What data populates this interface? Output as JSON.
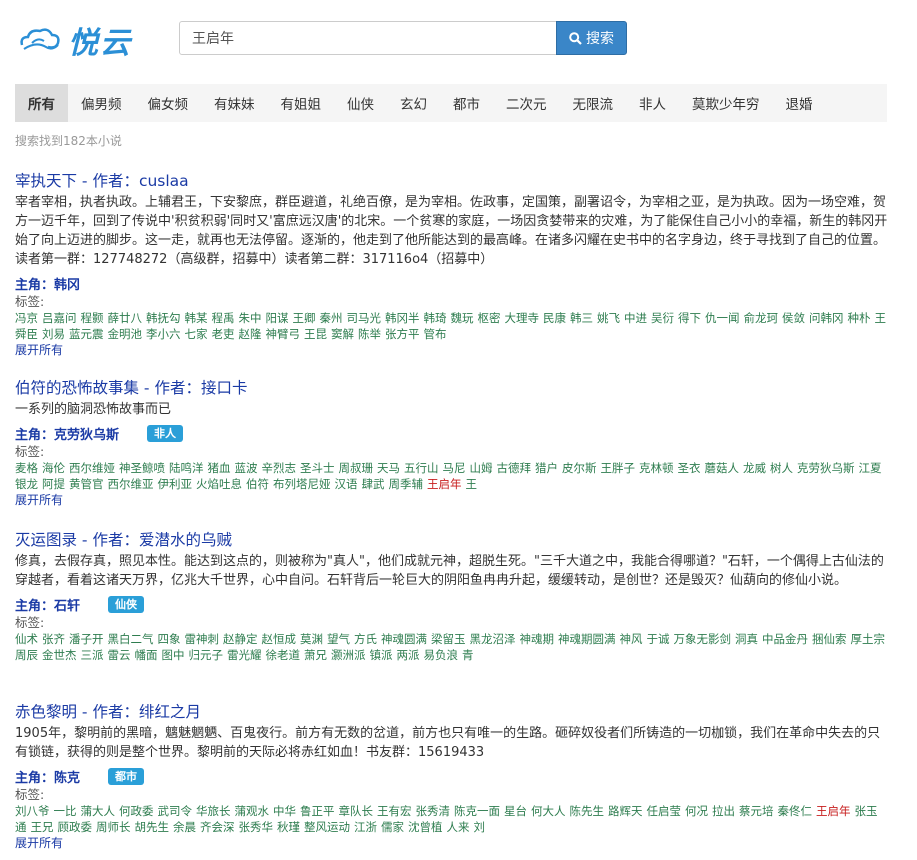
{
  "header": {
    "logo_text": "悦云",
    "search_value": "王启年",
    "search_button": "搜索"
  },
  "nav": [
    "所有",
    "偏男频",
    "偏女频",
    "有妹妹",
    "有姐姐",
    "仙侠",
    "玄幻",
    "都市",
    "二次元",
    "无限流",
    "非人",
    "莫欺少年穷",
    "退婚"
  ],
  "result_count": "搜索找到182本小说",
  "novels": [
    {
      "title": "宰执天下 - 作者：cuslaa",
      "desc": "宰者宰相，执者执政。上辅君王，下安黎庶，群臣避道，礼绝百僚，是为宰相。佐政事，定国策，副署诏令，为宰相之亚，是为执政。因为一场空难，贺方一迈千年，回到了传说中'积贫积弱'同时又'富庶远汉唐'的北宋。一个贫寒的家庭，一场因贪婪带来的灾难，为了能保住自己小小的幸福，新生的韩冈开始了向上迈进的脚步。这一走，就再也无法停留。逐渐的，他走到了他所能达到的最高峰。在诸多闪耀在史书中的名字身边，终于寻找到了自己的位置。读者第一群：127748272（高级群，招募中）读者第二群：317116o4（招募中）",
      "protag_label": "主角：韩冈",
      "badge": "",
      "tags_label": "标签:",
      "tags": [
        "冯京",
        "吕嘉问",
        "程颢",
        "薛廿八",
        "韩抚勾",
        "韩某",
        "程禹",
        "朱中",
        "阳谋",
        "王卿",
        "秦州",
        "司马光",
        "韩冈半",
        "韩琦",
        "魏玩",
        "枢密",
        "大理寺",
        "民康",
        "韩三",
        "姚飞",
        "中进",
        "吴衍",
        "得下",
        "仇一闻",
        "俞龙珂",
        "侯敛",
        "问韩冈",
        "种朴",
        "王舜臣",
        "刘易",
        "蓝元震",
        "金明池",
        "李小六",
        "七家",
        "老吏",
        "赵隆",
        "神臂弓",
        "王昆",
        "窦解",
        "陈举",
        "张方平",
        "管布"
      ],
      "expand": "展开所有"
    },
    {
      "title": "伯符的恐怖故事集 - 作者：接口卡",
      "desc": "一系列的脑洞恐怖故事而已",
      "protag_label": "主角：克劳狄乌斯",
      "badge": "非人",
      "tags_label": "标签:",
      "tags": [
        "麦格",
        "海伦",
        "西尔维娅",
        "神圣鲸喷",
        "陆鸣洋",
        "猪血",
        "蓝波",
        "辛烈志",
        "圣斗士",
        "周叔珊",
        "天马",
        "五行山",
        "马尼",
        "山姆",
        "古德拜",
        "猎户",
        "皮尔斯",
        "王胖子",
        "克林顿",
        "圣衣",
        "蘑菇人",
        "龙威",
        "树人",
        "克劳狄乌斯",
        "江夏",
        "银龙",
        "阿提",
        "黄管官",
        "西尔维亚",
        "伊利亚",
        "火焰吐息",
        "伯符",
        "布列塔尼娅",
        "汉语",
        "肆武",
        "周季辅",
        "王启年",
        "王"
      ],
      "highlight": "王启年",
      "expand": "展开所有"
    },
    {
      "title": "灭运图录 - 作者：爱潜水的乌贼",
      "desc": "修真，去假存真，照见本性。能达到这点的，则被称为\"真人\"，他们成就元神，超脱生死。\"三千大道之中，我能合得哪道？\"石轩，一个偶得上古仙法的穿越者，看着这诸天万界，亿兆大千世界，心中自问。石轩背后一轮巨大的阴阳鱼冉冉升起，缓缓转动，是创世？还是毁灭？仙葫向的修仙小说。",
      "protag_label": "主角：石轩",
      "badge": "仙侠",
      "tags_label": "标签:",
      "tags": [
        "仙术",
        "张齐",
        "潘子开",
        "黑白二气",
        "四象",
        "雷神刺",
        "赵静定",
        "赵恒成",
        "莫渊",
        "望气",
        "方氏",
        "神魂圆满",
        "梁留玉",
        "黑龙沼泽",
        "神魂期",
        "神魂期圆满",
        "神风",
        "于诚",
        "万象无影剑",
        "洞真",
        "中品金丹",
        "捆仙索",
        "厚土宗",
        "周辰",
        "金世杰",
        "三派",
        "雷云",
        "幡面",
        "图中",
        "归元子",
        "雷光耀",
        "徐老道",
        "萧兄",
        "灏洲派",
        "镇派",
        "两派",
        "易负浪",
        "青"
      ],
      "expand": ""
    },
    {
      "title": "赤色黎明 - 作者：绯红之月",
      "desc": "1905年，黎明前的黑暗，魑魅魍魉、百鬼夜行。前方有无数的岔道，前方也只有唯一的生路。砸碎奴役者们所铸造的一切枷锁，我们在革命中失去的只有锁链，获得的则是整个世界。黎明前的天际必将赤红如血！书友群：15619433",
      "protag_label": "主角：陈克",
      "badge": "都市",
      "tags_label": "标签:",
      "tags": [
        "刘八爷",
        "一比",
        "蒲大人",
        "何政委",
        "武司令",
        "华旅长",
        "蒲观水",
        "中华",
        "鲁正平",
        "章队长",
        "王有宏",
        "张秀清",
        "陈克一面",
        "星台",
        "何大人",
        "陈先生",
        "路辉天",
        "任启莹",
        "何况",
        "拉出",
        "蔡元培",
        "秦佟仁",
        "王启年",
        "张玉通",
        "王兄",
        "顾政委",
        "周师长",
        "胡先生",
        "余晨",
        "齐会深",
        "张秀华",
        "秋瑾",
        "整风运动",
        "江浙",
        "儒家",
        "沈曾植",
        "人来",
        "刘"
      ],
      "highlight": "王启年",
      "expand": "展开所有"
    }
  ]
}
